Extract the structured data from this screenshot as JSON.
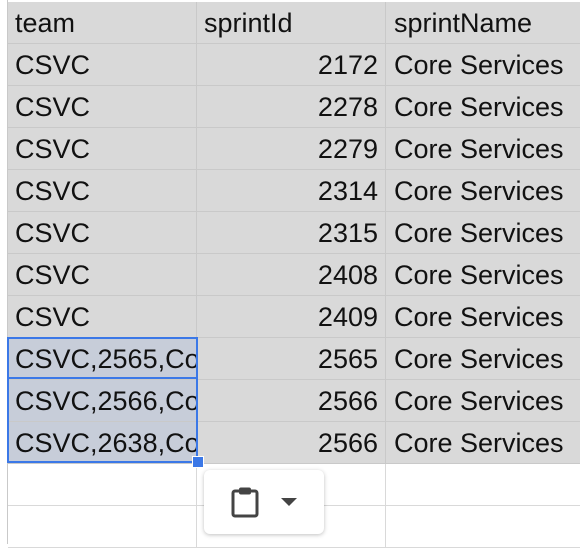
{
  "headers": [
    "team",
    "sprintId",
    "sprintName"
  ],
  "rows": [
    [
      "CSVC",
      "2172",
      "Core Services"
    ],
    [
      "CSVC",
      "2278",
      "Core Services"
    ],
    [
      "CSVC",
      "2279",
      "Core Services"
    ],
    [
      "CSVC",
      "2314",
      "Core Services"
    ],
    [
      "CSVC",
      "2315",
      "Core Services"
    ],
    [
      "CSVC",
      "2408",
      "Core Services"
    ],
    [
      "CSVC",
      "2409",
      "Core Services"
    ],
    [
      "CSVC,2565,Co",
      "2565",
      "Core Services"
    ],
    [
      "CSVC,2566,Co",
      "2566",
      "Core Services"
    ],
    [
      "CSVC,2638,Co",
      "2566",
      "Core Services"
    ]
  ],
  "paste_menu": {
    "icon": "clipboard-icon",
    "dropdown_icon": "caret-down-icon"
  },
  "colors": {
    "data_fill": "#d9d9d9",
    "selection_border": "#3b78e7",
    "selection_fill": "#c7cdd9"
  }
}
